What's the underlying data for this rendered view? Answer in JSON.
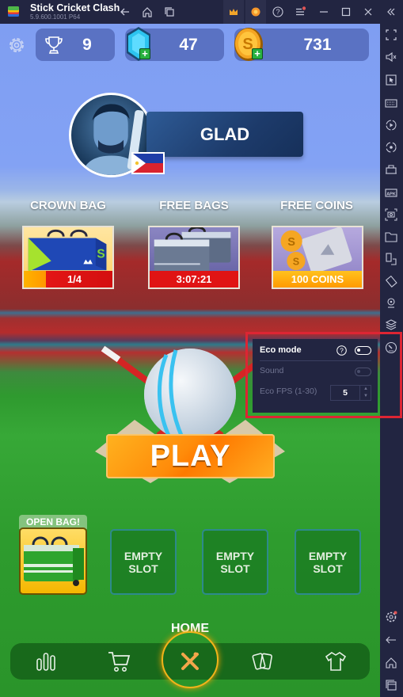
{
  "titlebar": {
    "app_title": "Stick Cricket Clash",
    "app_version": "5.9.600.1001 P64",
    "buttons": [
      "back-icon",
      "home-icon",
      "multi-instance-icon",
      "crown-icon",
      "bluestacks-points-icon",
      "help-icon",
      "menu-icon",
      "minimize-icon",
      "maximize-icon",
      "close-icon",
      "collapse-sidebar-icon"
    ]
  },
  "stats": {
    "trophies": "9",
    "gems": "47",
    "coins": "731"
  },
  "profile": {
    "name": "GLAD",
    "country_flag": "philippines-flag"
  },
  "offers": [
    {
      "label": "CROWN BAG",
      "bar_text": "1/4",
      "progress": 0.25
    },
    {
      "label": "FREE BAGS",
      "bar_text": "3:07:21"
    },
    {
      "label": "FREE COINS",
      "bar_text": "100 COINS"
    }
  ],
  "play": {
    "label": "PLAY"
  },
  "slots": {
    "open_bag_label": "OPEN BAG!",
    "empty_label_line1": "EMPTY",
    "empty_label_line2": "SLOT",
    "empty_count": 3
  },
  "nav": {
    "active_label": "HOME",
    "items": [
      "leaderboard-icon",
      "shop-cart-icon",
      "home-cricket-bats-icon",
      "cards-icon",
      "kit-shirt-icon"
    ]
  },
  "eco_panel": {
    "title": "Eco mode",
    "eco_enabled": false,
    "sound_label": "Sound",
    "sound_enabled": false,
    "fps_label": "Eco FPS (1-30)",
    "fps_value": "5"
  },
  "sidebar": {
    "items": [
      "fullscreen-icon",
      "volume-mute-icon",
      "pointer-icon",
      "keyboard-icon",
      "macro-record-icon",
      "sync-icon",
      "install-apk-build-icon",
      "apk-icon",
      "screenshot-icon",
      "folder-icon",
      "multi-instance-icon",
      "rotate-icon",
      "location-icon",
      "layers-icon",
      "eco-mode-gauge-icon",
      "settings-icon",
      "back-icon",
      "home-icon",
      "recent-apps-icon"
    ]
  },
  "colors": {
    "chrome_bg": "#222541",
    "highlight_frame": "#dd2533",
    "play_orange": "#ff8c0a",
    "ring_gold": "#f2b31a"
  }
}
